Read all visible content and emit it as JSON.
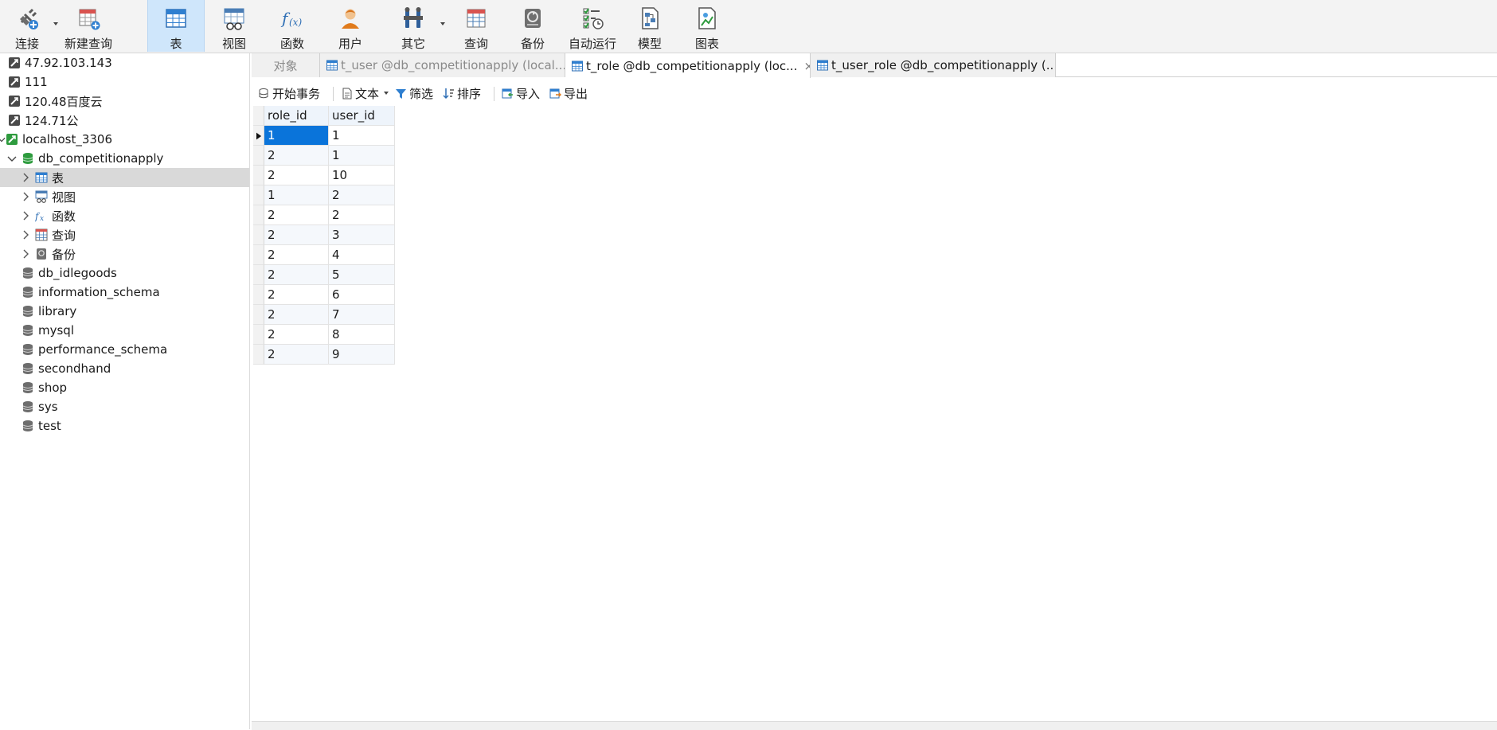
{
  "toolbar": {
    "connect": "连接",
    "new_query": "新建查询",
    "table": "表",
    "view": "视图",
    "function": "函数",
    "user": "用户",
    "other": "其它",
    "query": "查询",
    "backup": "备份",
    "auto_run": "自动运行",
    "model": "模型",
    "chart": "图表"
  },
  "nav": {
    "connections": [
      "47.92.103.143",
      "111",
      "120.48百度云",
      "124.71公"
    ],
    "localhost": "localhost_3306",
    "open_db": "db_competitionapply",
    "db_children": [
      "表",
      "视图",
      "函数",
      "查询",
      "备份"
    ],
    "other_dbs": [
      "db_idlegoods",
      "information_schema",
      "library",
      "mysql",
      "performance_schema",
      "secondhand",
      "shop",
      "sys",
      "test"
    ]
  },
  "tabs": {
    "objects": "对象",
    "t_user": "t_user @db_competitionapply (local...",
    "t_role": "t_role @db_competitionapply (loc...",
    "t_role_close": "×",
    "t_user_role": "t_user_role @db_competitionapply (..."
  },
  "subtoolbar": {
    "begin_tx": "开始事务",
    "text": "文本",
    "filter": "筛选",
    "sort": "排序",
    "import": "导入",
    "export": "导出"
  },
  "grid": {
    "columns": [
      "role_id",
      "user_id"
    ],
    "rows": [
      [
        "1",
        "1"
      ],
      [
        "2",
        "1"
      ],
      [
        "2",
        "10"
      ],
      [
        "1",
        "2"
      ],
      [
        "2",
        "2"
      ],
      [
        "2",
        "3"
      ],
      [
        "2",
        "4"
      ],
      [
        "2",
        "5"
      ],
      [
        "2",
        "6"
      ],
      [
        "2",
        "7"
      ],
      [
        "2",
        "8"
      ],
      [
        "2",
        "9"
      ]
    ]
  },
  "colors": {
    "selection": "#0a74da",
    "active_tool": "#cfe6fb",
    "db_green": "#2e9b3e"
  }
}
